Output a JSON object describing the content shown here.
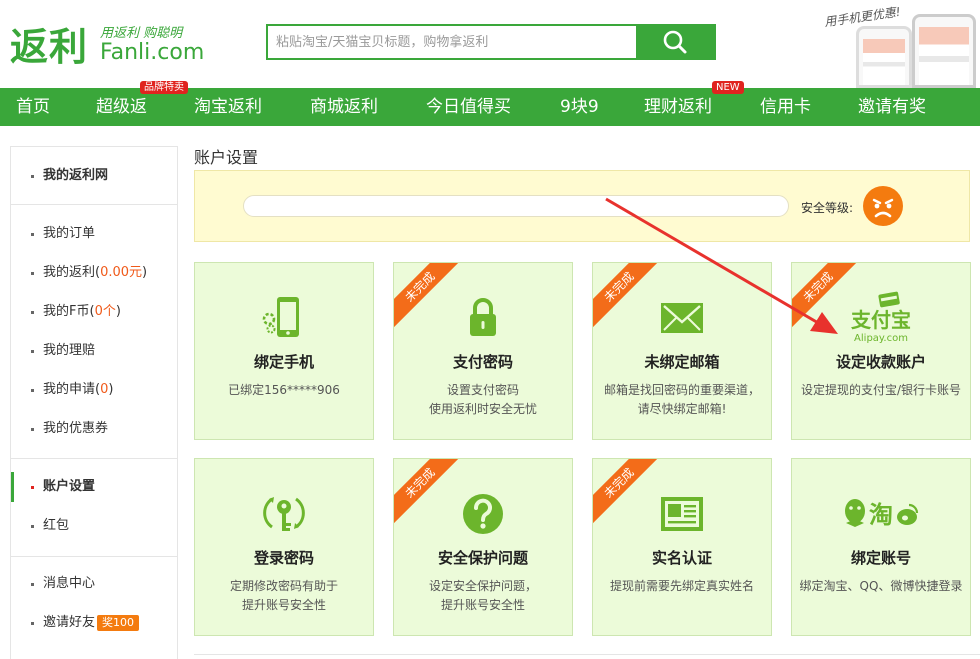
{
  "header": {
    "logo_mark": "返利",
    "logo_slogan": "用返利 购聪明",
    "logo_domain": "Fanli.com",
    "search_placeholder": "粘贴淘宝/天猫宝贝标题，购物拿返利",
    "app_promo_text": "用手机更优惠!"
  },
  "nav": {
    "items": [
      {
        "label": "首页"
      },
      {
        "label": "超级返",
        "badge": "品牌特卖"
      },
      {
        "label": "淘宝返利"
      },
      {
        "label": "商城返利"
      },
      {
        "label": "今日值得买"
      },
      {
        "label": "9块9"
      },
      {
        "label": "理财返利",
        "badge": "NEW"
      },
      {
        "label": "信用卡"
      },
      {
        "label": "邀请有奖"
      }
    ]
  },
  "sidebar": {
    "my_fanli": "我的返利网",
    "orders": "我的订单",
    "rebate_label": "我的返利",
    "rebate_value": "0.00元",
    "coins_label": "我的F币",
    "coins_value": "0个",
    "claims": "我的理赔",
    "applications_label": "我的申请",
    "applications_value": "0",
    "coupons": "我的优惠券",
    "account_settings": "账户设置",
    "red_packet": "红包",
    "messages": "消息中心",
    "invite": "邀请好友",
    "invite_reward": "奖100"
  },
  "main": {
    "page_title": "账户设置",
    "security_label": "安全等级:",
    "unfinished_tag": "未完成",
    "cards": [
      {
        "title": "绑定手机",
        "desc": "已绑定156*****906",
        "icon": "phone-icon",
        "unfinished": false
      },
      {
        "title": "支付密码",
        "desc": "设置支付密码\n使用返利时安全无忧",
        "icon": "lock-icon",
        "unfinished": true
      },
      {
        "title": "未绑定邮箱",
        "desc": "邮箱是找回密码的重要渠道，\n请尽快绑定邮箱!",
        "icon": "mail-icon",
        "unfinished": true
      },
      {
        "title": "设定收款账户",
        "desc": "设定提现的支付宝/银行卡账号",
        "icon": "alipay-icon",
        "unfinished": true
      },
      {
        "title": "登录密码",
        "desc": "定期修改密码有助于\n提升账号安全性",
        "icon": "key-icon",
        "unfinished": false
      },
      {
        "title": "安全保护问题",
        "desc": "设定安全保护问题，\n提升账号安全性",
        "icon": "question-icon",
        "unfinished": true
      },
      {
        "title": "实名认证",
        "desc": "提现前需要先绑定真实姓名",
        "icon": "id-card-icon",
        "unfinished": true
      },
      {
        "title": "绑定账号",
        "desc": "绑定淘宝、QQ、微博快捷登录",
        "icon": "social-accounts-icon",
        "unfinished": false
      }
    ],
    "alipay_logo_text": "支付宝",
    "alipay_logo_domain": "Alipay.com",
    "taobao_logo_text": "淘"
  },
  "colors": {
    "brand_green": "#3aa73a",
    "card_bg": "#ecfbd9",
    "ribbon_orange": "#f36c19",
    "security_bg": "#fffbd1",
    "arrow_red": "#e8322d",
    "badge_red": "#e0241f"
  }
}
